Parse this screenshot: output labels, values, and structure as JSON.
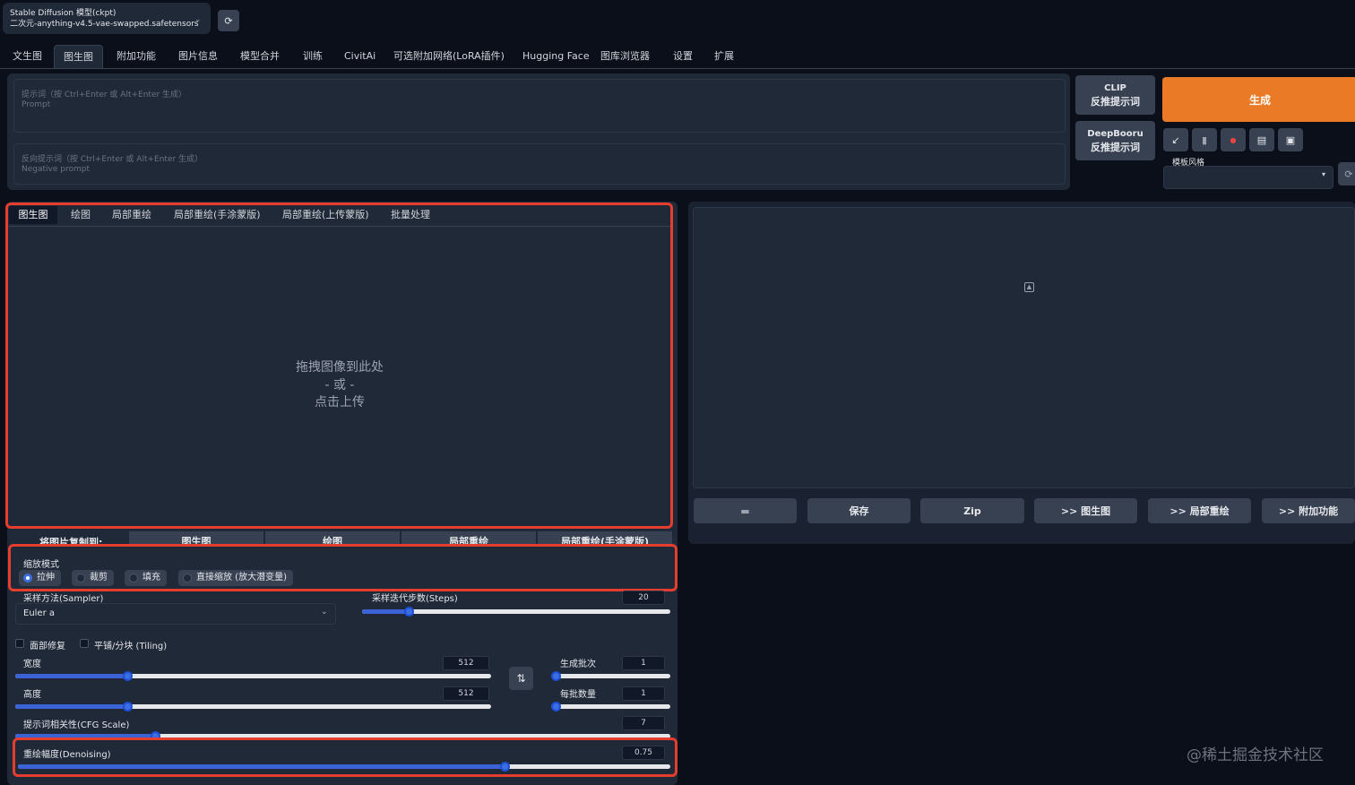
{
  "model": {
    "label": "Stable Diffusion 模型(ckpt)",
    "value": "二次元-anything-v4.5-vae-swapped.safetensors"
  },
  "tabs": [
    "文生图",
    "图生图",
    "附加功能",
    "图片信息",
    "模型合并",
    "训练",
    "CivitAi",
    "可选附加网络(LoRA插件)",
    "Hugging Face",
    "图库浏览器",
    "设置",
    "扩展"
  ],
  "prompt": {
    "placeholder_line1": "提示词（按 Ctrl+Enter 或 Alt+Enter 生成）",
    "placeholder_line2": "Prompt"
  },
  "negative_prompt": {
    "placeholder_line1": "反向提示词（按 Ctrl+Enter 或 Alt+Enter 生成）",
    "placeholder_line2": "Negative prompt"
  },
  "clip_button": {
    "line1": "CLIP",
    "line2": "反推提示词"
  },
  "deepbooru_button": {
    "line1": "DeepBooru",
    "line2": "反推提示词"
  },
  "generate_label": "生成",
  "style_label": "模板风格",
  "img_tabs": [
    "图生图",
    "绘图",
    "局部重绘",
    "局部重绘(手涂蒙版)",
    "局部重绘(上传蒙版)",
    "批量处理"
  ],
  "upload": {
    "line1": "拖拽图像到此处",
    "line2": "- 或 -",
    "line3": "点击上传"
  },
  "copy_to": {
    "label": "将图片复制到:",
    "targets": [
      "图生图",
      "绘图",
      "局部重绘",
      "局部重绘(手涂蒙版)"
    ]
  },
  "resize_mode": {
    "label": "缩放模式",
    "options": [
      "拉伸",
      "裁剪",
      "填充",
      "直接缩放 (放大潜变量)"
    ],
    "selected": 0
  },
  "sampler": {
    "label": "采样方法(Sampler)",
    "value": "Euler a"
  },
  "steps": {
    "label": "采样迭代步数(Steps)",
    "value": "20",
    "fraction": 0.14
  },
  "face_restore_label": "面部修复",
  "tiling_label": "平铺/分块 (Tiling)",
  "width": {
    "label": "宽度",
    "value": "512",
    "fraction": 0.23
  },
  "height": {
    "label": "高度",
    "value": "512",
    "fraction": 0.23
  },
  "batch_count": {
    "label": "生成批次",
    "value": "1",
    "fraction": 0.0
  },
  "batch_size": {
    "label": "每批数量",
    "value": "1",
    "fraction": 0.0
  },
  "cfg": {
    "label": "提示词相关性(CFG Scale)",
    "value": "7",
    "fraction": 0.21
  },
  "denoise": {
    "label": "重绘幅度(Denoising)",
    "value": "0.75",
    "fraction": 0.75
  },
  "output_buttons": [
    "保存",
    "Zip",
    ">> 图生图",
    ">> 局部重绘",
    ">> 附加功能"
  ],
  "watermark": "@稀土掘金技术社区",
  "colors": {
    "accent": "#ea7a26",
    "highlight": "#e53e2f",
    "slider": "#3b63d6"
  }
}
